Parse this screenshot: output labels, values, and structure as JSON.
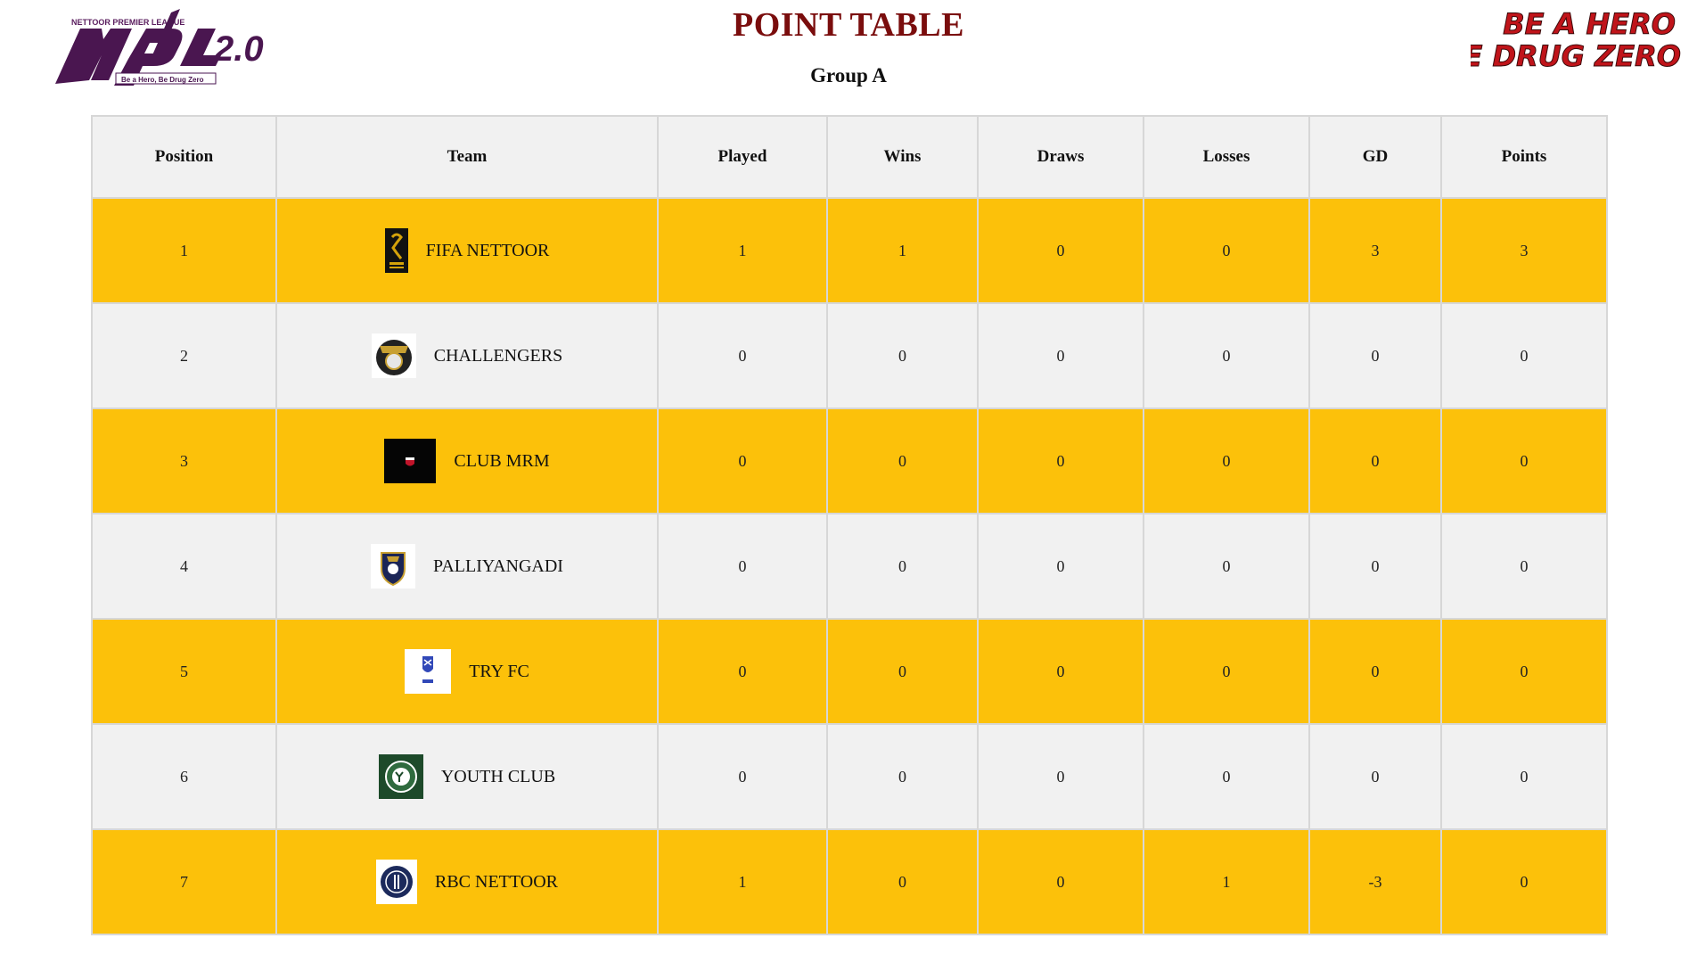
{
  "header": {
    "logo_top_text": "NETTOOR PREMIER LEAGUE",
    "logo_main_text": "npl",
    "logo_version": "2.0",
    "logo_tagline": "Be a Hero, Be Drug Zero",
    "title": "POINT TABLE",
    "group": "Group A",
    "slogan_line1": "BE A HERO",
    "slogan_line2": "BE DRUG ZERO"
  },
  "colors": {
    "title": "#7a0d0d",
    "row_highlight": "#fcc10a",
    "row_alt": "#f1f1f1",
    "logo_purple": "#4a1650",
    "slogan_red": "#c0141a"
  },
  "table": {
    "columns": [
      "Position",
      "Team",
      "Played",
      "Wins",
      "Draws",
      "Losses",
      "GD",
      "Points"
    ],
    "rows": [
      {
        "position": "1",
        "team": "FIFA NETTOOR",
        "logo_icon": "fifa-nettoor-logo-icon",
        "played": "1",
        "wins": "1",
        "draws": "0",
        "losses": "0",
        "gd": "3",
        "points": "3"
      },
      {
        "position": "2",
        "team": "CHALLENGERS",
        "logo_icon": "challengers-logo-icon",
        "played": "0",
        "wins": "0",
        "draws": "0",
        "losses": "0",
        "gd": "0",
        "points": "0"
      },
      {
        "position": "3",
        "team": "CLUB MRM",
        "logo_icon": "club-mrm-logo-icon",
        "played": "0",
        "wins": "0",
        "draws": "0",
        "losses": "0",
        "gd": "0",
        "points": "0"
      },
      {
        "position": "4",
        "team": "PALLIYANGADI",
        "logo_icon": "palliyangadi-logo-icon",
        "played": "0",
        "wins": "0",
        "draws": "0",
        "losses": "0",
        "gd": "0",
        "points": "0"
      },
      {
        "position": "5",
        "team": "TRY FC",
        "logo_icon": "try-fc-logo-icon",
        "played": "0",
        "wins": "0",
        "draws": "0",
        "losses": "0",
        "gd": "0",
        "points": "0"
      },
      {
        "position": "6",
        "team": "YOUTH CLUB",
        "logo_icon": "youth-club-logo-icon",
        "played": "0",
        "wins": "0",
        "draws": "0",
        "losses": "0",
        "gd": "0",
        "points": "0"
      },
      {
        "position": "7",
        "team": "RBC NETTOOR",
        "logo_icon": "rbc-nettoor-logo-icon",
        "played": "1",
        "wins": "0",
        "draws": "0",
        "losses": "1",
        "gd": "-3",
        "points": "0"
      }
    ]
  }
}
